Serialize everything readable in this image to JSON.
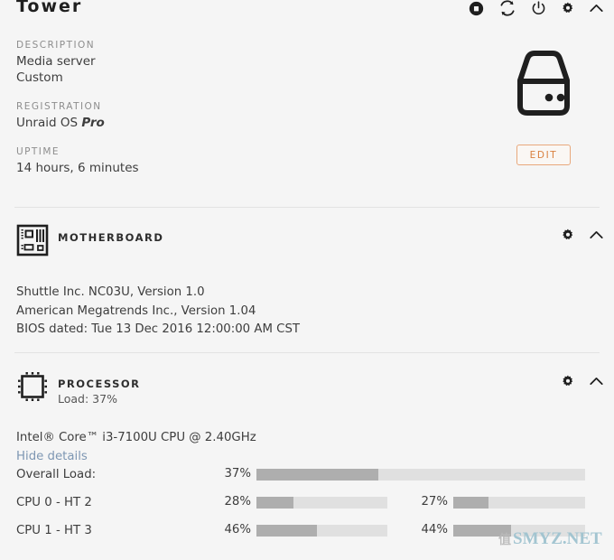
{
  "header": {
    "title": "Tower",
    "icons": [
      {
        "name": "stop-icon",
        "label": "Stop"
      },
      {
        "name": "refresh-icon",
        "label": "Refresh"
      },
      {
        "name": "power-icon",
        "label": "Power"
      },
      {
        "name": "gear-icon",
        "label": "Settings"
      },
      {
        "name": "chevron-up-icon",
        "label": "Collapse"
      }
    ]
  },
  "overview": {
    "description_label": "DESCRIPTION",
    "description_line1": "Media server",
    "description_line2": "Custom",
    "registration_label": "REGISTRATION",
    "registration_os": "Unraid OS",
    "registration_tier": "Pro",
    "uptime_label": "UPTIME",
    "uptime_value": "14 hours, 6 minutes",
    "edit_label": "EDIT",
    "server_icon": "server-tower-icon"
  },
  "motherboard": {
    "icon": "motherboard-icon",
    "title": "MOTHERBOARD",
    "lines": [
      "Shuttle Inc. NC03U, Version 1.0",
      "American Megatrends Inc., Version 1.04",
      "BIOS dated: Tue 13 Dec 2016 12:00:00 AM CST"
    ],
    "tools": [
      {
        "name": "gear-icon",
        "label": "Settings"
      },
      {
        "name": "chevron-up-icon",
        "label": "Collapse"
      }
    ]
  },
  "processor": {
    "icon": "cpu-icon",
    "title": "PROCESSOR",
    "subtitle": "Load: 37%",
    "model": "Intel® Core™ i3-7100U CPU @ 2.40GHz",
    "details_toggle": "Hide details",
    "tools": [
      {
        "name": "gear-icon",
        "label": "Settings"
      },
      {
        "name": "chevron-up-icon",
        "label": "Collapse"
      }
    ],
    "loads": [
      {
        "label": "Overall Load:",
        "pct_a": "37%",
        "value_a": 37,
        "wide": true
      },
      {
        "label": "CPU 0 - HT 2",
        "pct_a": "28%",
        "value_a": 28,
        "pct_b": "27%",
        "value_b": 27,
        "wide": false
      },
      {
        "label": "CPU 1 - HT 3",
        "pct_a": "46%",
        "value_a": 46,
        "pct_b": "44%",
        "value_b": 44,
        "wide": false
      }
    ]
  },
  "watermark": {
    "cn": "值",
    "text": "SMYZ.NET"
  },
  "colors": {
    "background": "#f5f5f5",
    "accent_orange": "#d9803f",
    "link_blue": "#7e97b3",
    "bar_fill": "#aeaeae",
    "bar_track": "#e0e0e0",
    "divider": "#e3e3e3"
  }
}
